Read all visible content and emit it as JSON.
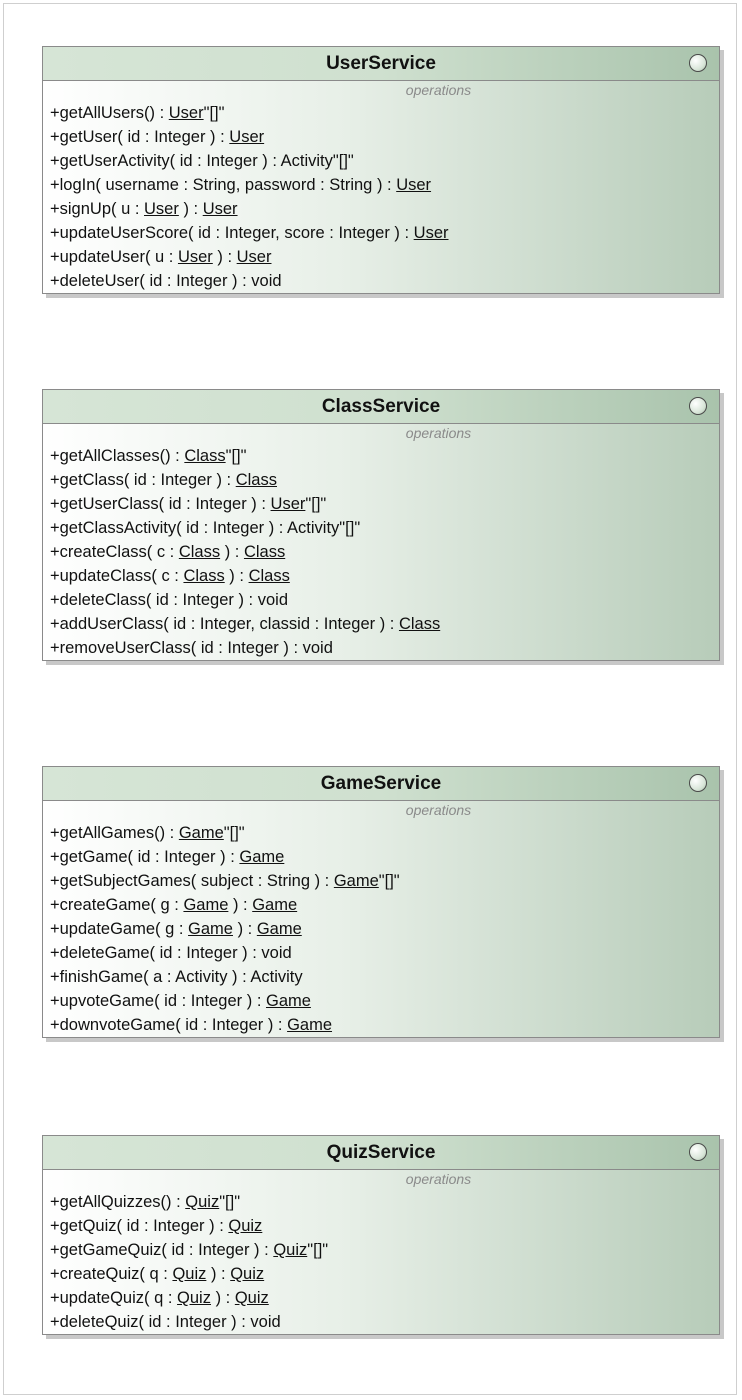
{
  "diagram": {
    "classes": [
      {
        "name": "UserService",
        "section_label": "operations",
        "operations": [
          [
            {
              "t": "+getAllUsers() : "
            },
            {
              "t": "User",
              "u": true
            },
            {
              "t": "\"[]\""
            }
          ],
          [
            {
              "t": "+getUser( id : Integer ) : "
            },
            {
              "t": "User",
              "u": true
            }
          ],
          [
            {
              "t": "+getUserActivity( id : Integer ) : Activity\"[]\""
            }
          ],
          [
            {
              "t": "+logIn( username : String, password : String ) : "
            },
            {
              "t": "User",
              "u": true
            }
          ],
          [
            {
              "t": "+signUp( u : "
            },
            {
              "t": "User",
              "u": true
            },
            {
              "t": " ) : "
            },
            {
              "t": "User",
              "u": true
            }
          ],
          [
            {
              "t": "+updateUserScore( id : Integer, score : Integer ) : "
            },
            {
              "t": "User",
              "u": true
            }
          ],
          [
            {
              "t": "+updateUser( u : "
            },
            {
              "t": "User",
              "u": true
            },
            {
              "t": " ) : "
            },
            {
              "t": "User",
              "u": true
            }
          ],
          [
            {
              "t": "+deleteUser( id : Integer ) : void"
            }
          ]
        ]
      },
      {
        "name": "ClassService",
        "section_label": "operations",
        "operations": [
          [
            {
              "t": "+getAllClasses() : "
            },
            {
              "t": "Class",
              "u": true
            },
            {
              "t": "\"[]\""
            }
          ],
          [
            {
              "t": "+getClass( id : Integer ) : "
            },
            {
              "t": "Class",
              "u": true
            }
          ],
          [
            {
              "t": "+getUserClass( id : Integer ) : "
            },
            {
              "t": "User",
              "u": true
            },
            {
              "t": "\"[]\""
            }
          ],
          [
            {
              "t": "+getClassActivity( id : Integer ) : Activity\"[]\""
            }
          ],
          [
            {
              "t": "+createClass( c : "
            },
            {
              "t": "Class",
              "u": true
            },
            {
              "t": " ) : "
            },
            {
              "t": "Class",
              "u": true
            }
          ],
          [
            {
              "t": "+updateClass( c : "
            },
            {
              "t": "Class",
              "u": true
            },
            {
              "t": " ) : "
            },
            {
              "t": "Class",
              "u": true
            }
          ],
          [
            {
              "t": "+deleteClass( id : Integer ) : void"
            }
          ],
          [
            {
              "t": "+addUserClass( id : Integer, classid : Integer ) : "
            },
            {
              "t": "Class",
              "u": true
            }
          ],
          [
            {
              "t": "+removeUserClass( id : Integer ) : void"
            }
          ]
        ]
      },
      {
        "name": "GameService",
        "section_label": "operations",
        "operations": [
          [
            {
              "t": "+getAllGames() : "
            },
            {
              "t": "Game",
              "u": true
            },
            {
              "t": "\"[]\""
            }
          ],
          [
            {
              "t": "+getGame( id : Integer ) : "
            },
            {
              "t": "Game",
              "u": true
            }
          ],
          [
            {
              "t": "+getSubjectGames( subject : String ) : "
            },
            {
              "t": "Game",
              "u": true
            },
            {
              "t": "\"[]\""
            }
          ],
          [
            {
              "t": "+createGame( g : "
            },
            {
              "t": "Game",
              "u": true
            },
            {
              "t": " ) : "
            },
            {
              "t": "Game",
              "u": true
            }
          ],
          [
            {
              "t": "+updateGame( g : "
            },
            {
              "t": "Game",
              "u": true
            },
            {
              "t": " ) : "
            },
            {
              "t": "Game",
              "u": true
            }
          ],
          [
            {
              "t": "+deleteGame( id : Integer ) : void"
            }
          ],
          [
            {
              "t": "+finishGame( a : Activity ) : Activity"
            }
          ],
          [
            {
              "t": "+upvoteGame( id : Integer ) : "
            },
            {
              "t": "Game",
              "u": true
            }
          ],
          [
            {
              "t": "+downvoteGame( id : Integer ) : "
            },
            {
              "t": "Game",
              "u": true
            }
          ]
        ]
      },
      {
        "name": "QuizService",
        "section_label": "operations",
        "operations": [
          [
            {
              "t": "+getAllQuizzes() : "
            },
            {
              "t": "Quiz",
              "u": true
            },
            {
              "t": "\"[]\""
            }
          ],
          [
            {
              "t": "+getQuiz( id : Integer ) : "
            },
            {
              "t": "Quiz",
              "u": true
            }
          ],
          [
            {
              "t": "+getGameQuiz( id : Integer ) : "
            },
            {
              "t": "Quiz",
              "u": true
            },
            {
              "t": "\"[]\""
            }
          ],
          [
            {
              "t": "+createQuiz( q : "
            },
            {
              "t": "Quiz",
              "u": true
            },
            {
              "t": " ) : "
            },
            {
              "t": "Quiz",
              "u": true
            }
          ],
          [
            {
              "t": "+updateQuiz( q : "
            },
            {
              "t": "Quiz",
              "u": true
            },
            {
              "t": " ) : "
            },
            {
              "t": "Quiz",
              "u": true
            }
          ],
          [
            {
              "t": "+deleteQuiz( id : Integer ) : void"
            }
          ]
        ]
      }
    ]
  }
}
